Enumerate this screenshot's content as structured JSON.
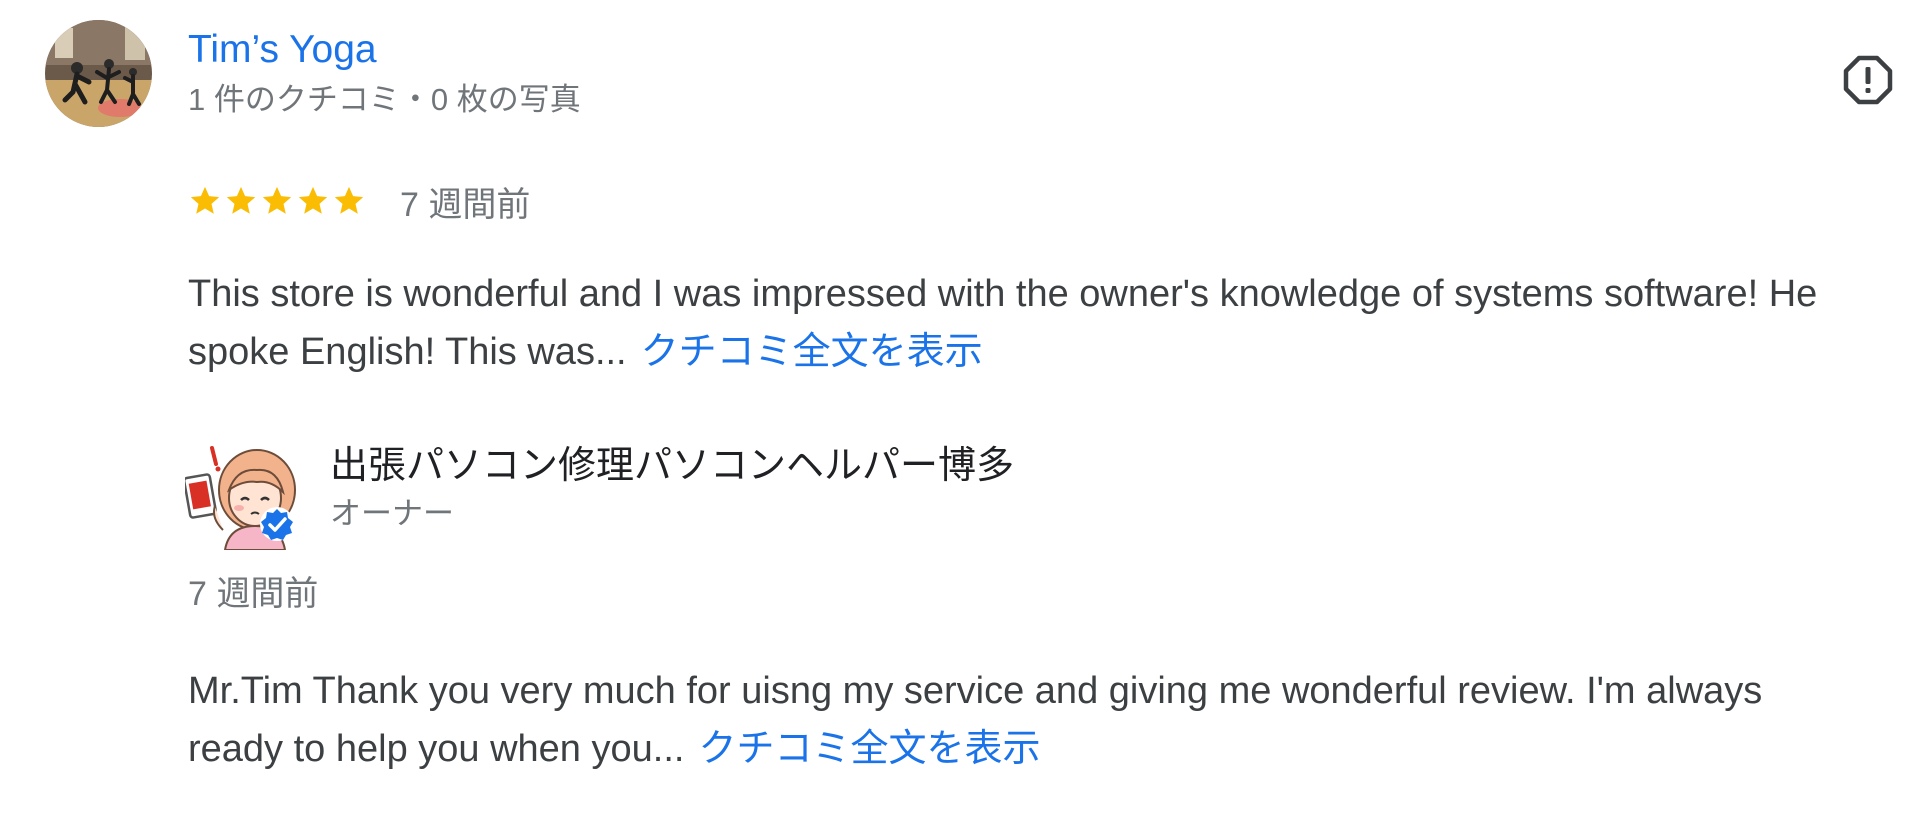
{
  "review": {
    "reviewer": {
      "name": "Tim’s Yoga",
      "meta": "1 件のクチコミ・0 枚の写真",
      "avatar_icon": "yoga-studio-photo-avatar"
    },
    "report_icon": "report-flag-icon",
    "rating": {
      "stars": 5,
      "max": 5,
      "star_color": "#fbbc04"
    },
    "time": "7 週間前",
    "text": "This store is wonderful and I was impressed with the owner's knowledge of systems software! He spoke English! This was...",
    "more_label": "クチコミ全文を表示"
  },
  "owner_reply": {
    "name": "出張パソコン修理パソコンヘルパー博多",
    "label": "オーナー",
    "avatar_icon": "cartoon-character-avatar",
    "verified_icon": "verified-badge-icon",
    "time": "7 週間前",
    "text": "Mr.Tim Thank you very much for uisng my service and giving me wonderful review. I'm always ready to help you when you...",
    "more_label": "クチコミ全文を表示"
  },
  "colors": {
    "link": "#1a73e8",
    "secondary_text": "#70757a",
    "body_text": "#3c4043",
    "verified": "#1a73e8"
  }
}
